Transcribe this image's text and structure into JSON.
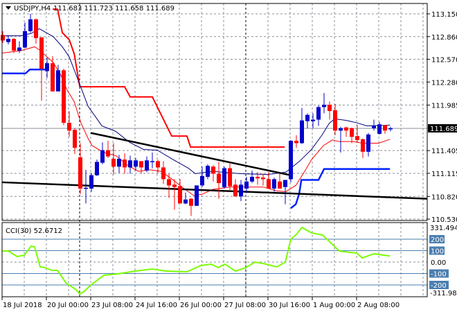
{
  "chart_data": {
    "type": "candlestick",
    "title": {
      "symbol": "USDJPY,H4",
      "ohlc": "111.683 111.723 111.658 111.689"
    },
    "colors": {
      "bull": "#0000cc",
      "bear": "#ff0000",
      "ma_fast": "#ff0000",
      "ma_slow": "#00007f",
      "step_red": "#ff0000",
      "step_blue": "#0022ff",
      "trend": "#000000",
      "cci": "#7cfc00",
      "level_box": "#4a7eb0"
    },
    "price_axis": {
      "ticks": [
        "113.150",
        "112.860",
        "112.570",
        "112.280",
        "111.985",
        "111.405",
        "111.115",
        "110.820",
        "110.530"
      ],
      "current": "111.689",
      "ylim": [
        110.53,
        113.15
      ]
    },
    "time_axis": {
      "ticks": [
        "18 Jul 2018",
        "20 Jul 00:00",
        "23 Jul 08:00",
        "24 Jul 16:00",
        "26 Jul 00:00",
        "27 Jul 08:00",
        "30 Jul 16:00",
        "1 Aug 00:00",
        "2 Aug 08:00"
      ]
    },
    "candles_ohlc": [
      [
        112.88,
        112.93,
        112.78,
        112.81
      ],
      [
        112.79,
        112.88,
        112.76,
        112.83
      ],
      [
        112.83,
        112.84,
        112.65,
        112.68
      ],
      [
        112.68,
        112.8,
        112.65,
        112.72
      ],
      [
        112.72,
        113.04,
        112.71,
        112.93
      ],
      [
        112.93,
        113.15,
        112.91,
        113.08
      ],
      [
        113.08,
        113.09,
        112.77,
        112.84
      ],
      [
        112.85,
        112.85,
        112.04,
        112.45
      ],
      [
        112.42,
        112.59,
        112.33,
        112.52
      ],
      [
        112.52,
        112.61,
        112.16,
        112.16
      ],
      [
        112.16,
        112.5,
        112.16,
        112.43
      ],
      [
        112.43,
        112.45,
        111.73,
        111.76
      ],
      [
        111.76,
        111.91,
        111.58,
        111.66
      ],
      [
        111.67,
        111.69,
        111.36,
        111.44
      ],
      [
        111.32,
        111.5,
        110.85,
        110.92
      ],
      [
        110.92,
        111.16,
        110.73,
        110.93
      ],
      [
        110.92,
        111.12,
        110.88,
        111.09
      ],
      [
        111.09,
        111.29,
        111.08,
        111.26
      ],
      [
        111.25,
        111.51,
        111.23,
        111.41
      ],
      [
        111.41,
        111.53,
        111.31,
        111.33
      ],
      [
        111.3,
        111.5,
        111.1,
        111.2
      ],
      [
        111.2,
        111.35,
        111.12,
        111.3
      ],
      [
        111.29,
        111.37,
        111.11,
        111.19
      ],
      [
        111.19,
        111.34,
        111.11,
        111.28
      ],
      [
        111.2,
        111.31,
        111.15,
        111.28
      ],
      [
        111.27,
        111.27,
        111.11,
        111.19
      ],
      [
        111.15,
        111.33,
        111.13,
        111.28
      ],
      [
        111.27,
        111.38,
        111.18,
        111.27
      ],
      [
        111.27,
        111.29,
        111.11,
        111.19
      ],
      [
        111.19,
        111.27,
        110.98,
        111.04
      ],
      [
        111.04,
        111.11,
        110.8,
        110.96
      ],
      [
        110.97,
        111.04,
        110.65,
        110.94
      ],
      [
        110.95,
        111.04,
        110.73,
        110.73
      ],
      [
        110.73,
        110.87,
        110.72,
        110.78
      ],
      [
        110.79,
        110.8,
        110.57,
        110.7
      ],
      [
        110.7,
        110.96,
        110.7,
        110.96
      ],
      [
        110.96,
        111.2,
        110.94,
        111.08
      ],
      [
        111.07,
        111.23,
        111.04,
        111.21
      ],
      [
        111.2,
        111.22,
        111.01,
        111.11
      ],
      [
        111.11,
        111.26,
        110.79,
        110.99
      ],
      [
        110.94,
        111.2,
        110.92,
        111.18
      ],
      [
        111.18,
        111.24,
        110.89,
        110.95
      ],
      [
        110.97,
        111.04,
        110.82,
        110.82
      ],
      [
        110.82,
        111.03,
        110.76,
        110.97
      ],
      [
        110.92,
        111.07,
        110.86,
        111.01
      ],
      [
        111.01,
        111.15,
        110.99,
        111.07
      ],
      [
        111.07,
        111.13,
        110.97,
        111.05
      ],
      [
        111.06,
        111.11,
        110.96,
        111.04
      ],
      [
        111.04,
        111.13,
        110.92,
        110.92
      ],
      [
        110.92,
        111.06,
        110.88,
        111.04
      ],
      [
        111.01,
        111.11,
        110.92,
        110.92
      ],
      [
        110.94,
        111.03,
        110.72,
        111.03
      ],
      [
        111.04,
        111.54,
        111.0,
        111.53
      ],
      [
        111.53,
        111.6,
        111.44,
        111.5
      ],
      [
        111.5,
        111.95,
        111.49,
        111.79
      ],
      [
        111.78,
        111.88,
        111.69,
        111.86
      ],
      [
        111.78,
        111.88,
        111.69,
        111.8
      ],
      [
        111.8,
        111.98,
        111.72,
        111.96
      ],
      [
        111.96,
        112.14,
        111.88,
        111.99
      ],
      [
        111.99,
        112.03,
        111.8,
        111.91
      ],
      [
        111.92,
        112.0,
        111.6,
        111.66
      ],
      [
        111.66,
        111.71,
        111.38,
        111.69
      ],
      [
        111.7,
        111.71,
        111.58,
        111.66
      ],
      [
        111.69,
        111.7,
        111.5,
        111.58
      ],
      [
        111.59,
        111.73,
        111.51,
        111.54
      ],
      [
        111.55,
        111.56,
        111.31,
        111.39
      ],
      [
        111.39,
        111.63,
        111.33,
        111.61
      ],
      [
        111.69,
        111.8,
        111.66,
        111.72
      ],
      [
        111.62,
        111.77,
        111.61,
        111.74
      ],
      [
        111.73,
        111.73,
        111.62,
        111.66
      ],
      [
        111.68,
        111.71,
        111.65,
        111.689
      ]
    ],
    "ma_fast": [
      [
        -0.1,
        112.65
      ],
      [
        3.25,
        112.68
      ],
      [
        5.75,
        112.73
      ],
      [
        6.6,
        112.69
      ],
      [
        9.1,
        112.53
      ],
      [
        10.4,
        112.38
      ],
      [
        11.6,
        112.18
      ],
      [
        12.9,
        112.03
      ],
      [
        14.1,
        111.76
      ],
      [
        15.4,
        111.56
      ],
      [
        16.1,
        111.47
      ],
      [
        18.25,
        111.38
      ],
      [
        20.4,
        111.34
      ],
      [
        22.9,
        111.2
      ],
      [
        24.5,
        111.14
      ],
      [
        26.6,
        111.16
      ],
      [
        28.6,
        111.14
      ],
      [
        30.75,
        111.03
      ],
      [
        32.9,
        110.91
      ],
      [
        34.5,
        110.83
      ],
      [
        36.1,
        110.85
      ],
      [
        37.9,
        110.91
      ],
      [
        41.1,
        110.94
      ],
      [
        47,
        110.94
      ],
      [
        49.5,
        110.89
      ],
      [
        51.1,
        110.88
      ],
      [
        52.9,
        110.96
      ],
      [
        54.5,
        111.14
      ],
      [
        55.75,
        111.29
      ],
      [
        57.9,
        111.47
      ],
      [
        59.5,
        111.54
      ],
      [
        60.75,
        111.52
      ],
      [
        63.25,
        111.52
      ],
      [
        64.9,
        111.5
      ],
      [
        67.9,
        111.5
      ],
      [
        69.9,
        111.55
      ]
    ],
    "ma_slow": [
      [
        -0.1,
        112.87
      ],
      [
        3.25,
        112.87
      ],
      [
        5.1,
        112.9
      ],
      [
        6.6,
        112.96
      ],
      [
        9.1,
        112.86
      ],
      [
        10.75,
        112.73
      ],
      [
        12,
        112.6
      ],
      [
        13.25,
        112.37
      ],
      [
        15.4,
        111.97
      ],
      [
        17.9,
        111.72
      ],
      [
        20.4,
        111.65
      ],
      [
        22.9,
        111.51
      ],
      [
        25.4,
        111.42
      ],
      [
        27.9,
        111.41
      ],
      [
        30.75,
        111.29
      ],
      [
        33.5,
        111.18
      ],
      [
        34.75,
        111.11
      ],
      [
        37.9,
        111.14
      ],
      [
        42.9,
        111.11
      ],
      [
        47.9,
        111.1
      ],
      [
        51.1,
        111.13
      ],
      [
        53.6,
        111.27
      ],
      [
        55.75,
        111.42
      ],
      [
        57.6,
        111.6
      ],
      [
        58.9,
        111.75
      ],
      [
        59.9,
        111.81
      ],
      [
        62,
        111.79
      ],
      [
        63.9,
        111.76
      ],
      [
        65.75,
        111.72
      ],
      [
        69.9,
        111.73
      ]
    ],
    "step_red": [
      [
        9,
        113.21
      ],
      [
        9.9,
        113.21
      ],
      [
        10.75,
        112.91
      ],
      [
        12,
        112.82
      ],
      [
        12.9,
        112.64
      ],
      [
        13.9,
        112.22
      ],
      [
        22,
        112.22
      ],
      [
        23,
        112.09
      ],
      [
        27,
        112.09
      ],
      [
        30.5,
        111.59
      ],
      [
        33.25,
        111.59
      ],
      [
        33.9,
        111.45
      ],
      [
        50.9,
        111.45
      ]
    ],
    "step_blue_1": [
      [
        -0.1,
        112.39
      ],
      [
        4.1,
        112.39
      ],
      [
        4.9,
        112.44
      ],
      [
        7.9,
        112.44
      ]
    ],
    "step_blue_2": [
      [
        52,
        110.67
      ],
      [
        52.9,
        110.72
      ],
      [
        53.5,
        110.85
      ],
      [
        53.9,
        111.03
      ],
      [
        57,
        111.03
      ],
      [
        58,
        111.17
      ],
      [
        69.9,
        111.17
      ]
    ],
    "trendlines": [
      [
        [
          -0.1,
          111.0
        ],
        [
          76.6,
          110.79
        ]
      ],
      [
        [
          15.9,
          111.63
        ],
        [
          52,
          111.09
        ]
      ]
    ],
    "cci": {
      "label": "CCI(30) 52.6712",
      "axis_top": "331.4942",
      "axis_bottom": "-311.9848",
      "levels": [
        "200",
        "100",
        "0.00",
        "-100",
        "-200"
      ],
      "values": [
        [
          -0.1,
          97
        ],
        [
          1,
          97
        ],
        [
          2.6,
          48
        ],
        [
          3.9,
          61
        ],
        [
          5.1,
          139
        ],
        [
          5.75,
          133
        ],
        [
          6.75,
          -42
        ],
        [
          7.6,
          -48
        ],
        [
          8.9,
          -73
        ],
        [
          9.9,
          -73
        ],
        [
          11.4,
          -182
        ],
        [
          13.25,
          -242
        ],
        [
          13.9,
          -279
        ],
        [
          14.75,
          -255
        ],
        [
          15.75,
          -206
        ],
        [
          18.25,
          -115
        ],
        [
          20.75,
          -103
        ],
        [
          23.9,
          -79
        ],
        [
          27,
          -61
        ],
        [
          29.5,
          -79
        ],
        [
          33.25,
          -85
        ],
        [
          35.75,
          -30
        ],
        [
          37.6,
          -18
        ],
        [
          38.9,
          -48
        ],
        [
          40.1,
          -18
        ],
        [
          42,
          -79
        ],
        [
          43.9,
          -48
        ],
        [
          45.5,
          0
        ],
        [
          47,
          -12
        ],
        [
          49.5,
          -42
        ],
        [
          51,
          0
        ],
        [
          52,
          200
        ],
        [
          53,
          242
        ],
        [
          54,
          303
        ],
        [
          55.75,
          255
        ],
        [
          57.75,
          236
        ],
        [
          60.75,
          97
        ],
        [
          62.6,
          85
        ],
        [
          63.9,
          79
        ],
        [
          64.9,
          36
        ],
        [
          67,
          73
        ],
        [
          69.9,
          53
        ]
      ]
    }
  }
}
